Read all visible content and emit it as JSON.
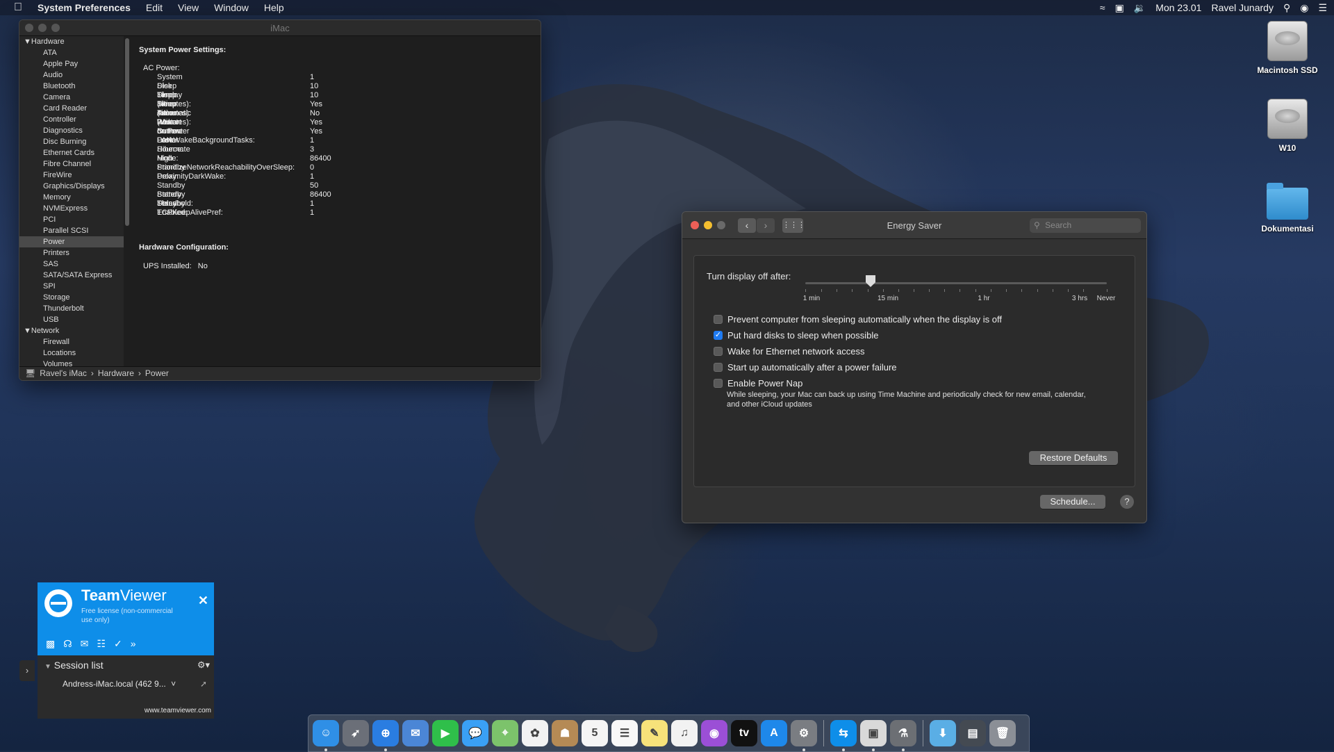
{
  "menubar": {
    "app_name": "System Preferences",
    "menus": [
      "Edit",
      "View",
      "Window",
      "Help"
    ],
    "clock": "Mon 23.01",
    "user": "Ravel Junardy"
  },
  "desktop": {
    "icons": [
      {
        "label": "Macintosh SSD",
        "icon": "hard-disk-icon"
      },
      {
        "label": "W10",
        "icon": "hard-disk-icon"
      },
      {
        "label": "Dokumentasi",
        "icon": "folder-icon"
      }
    ]
  },
  "sysinfo": {
    "title": "iMac",
    "sidebar_groups": [
      {
        "label": "Hardware",
        "items": [
          "ATA",
          "Apple Pay",
          "Audio",
          "Bluetooth",
          "Camera",
          "Card Reader",
          "Controller",
          "Diagnostics",
          "Disc Burning",
          "Ethernet Cards",
          "Fibre Channel",
          "FireWire",
          "Graphics/Displays",
          "Memory",
          "NVMExpress",
          "PCI",
          "Parallel SCSI",
          "Power",
          "Printers",
          "SAS",
          "SATA/SATA Express",
          "SPI",
          "Storage",
          "Thunderbolt",
          "USB"
        ]
      },
      {
        "label": "Network",
        "items": [
          "Firewall",
          "Locations",
          "Volumes"
        ]
      }
    ],
    "selected_item": "Power",
    "detail": {
      "power_settings_heading": "System Power Settings:",
      "ac_power_label": "AC Power:",
      "settings": [
        {
          "key": "System Sleep Timer (Minutes):",
          "value": "1"
        },
        {
          "key": "Disk Sleep Timer (Minutes):",
          "value": "10"
        },
        {
          "key": "Display Sleep Timer (Minutes):",
          "value": "10"
        },
        {
          "key": "Sleep on Power Button:",
          "value": "Yes"
        },
        {
          "key": "Automatic Restart on Power Loss:",
          "value": "No"
        },
        {
          "key": "Wake on LAN:",
          "value": "Yes"
        },
        {
          "key": "Current Power Source:",
          "value": "Yes"
        },
        {
          "key": "DarkWakeBackgroundTasks:",
          "value": "1"
        },
        {
          "key": "Hibernate Mode:",
          "value": "3"
        },
        {
          "key": "High Standby Delay:",
          "value": "86400"
        },
        {
          "key": "PrioritizeNetworkReachabilityOverSleep:",
          "value": "0"
        },
        {
          "key": "ProximityDarkWake:",
          "value": "1"
        },
        {
          "key": "Standby Battery Threshold:",
          "value": "50"
        },
        {
          "key": "Standby Delay:",
          "value": "86400"
        },
        {
          "key": "Standby Enabled:",
          "value": "1"
        },
        {
          "key": "TCPKeepAlivePref:",
          "value": "1"
        }
      ],
      "hardware_config_heading": "Hardware Configuration:",
      "ups_label": "UPS Installed:",
      "ups_value": "No"
    },
    "pathbar": [
      "Ravel's iMac",
      "Hardware",
      "Power"
    ]
  },
  "energy_saver": {
    "title": "Energy Saver",
    "search_placeholder": "Search",
    "slider": {
      "label": "Turn display off after:",
      "value_minutes": 10,
      "tick_labels": [
        "1 min",
        "15 min",
        "1 hr",
        "3 hrs",
        "Never"
      ]
    },
    "options": [
      {
        "label": "Prevent computer from sleeping automatically when the display is off",
        "checked": false
      },
      {
        "label": "Put hard disks to sleep when possible",
        "checked": true
      },
      {
        "label": "Wake for Ethernet network access",
        "checked": false
      },
      {
        "label": "Start up automatically after a power failure",
        "checked": false
      },
      {
        "label": "Enable Power Nap",
        "checked": false
      }
    ],
    "power_nap_note": "While sleeping, your Mac can back up using Time Machine and periodically check for new email, calendar, and other iCloud updates",
    "restore_button": "Restore Defaults",
    "schedule_button": "Schedule...",
    "help_label": "?"
  },
  "teamviewer": {
    "brand_team": "Team",
    "brand_viewer": "Viewer",
    "license": "Free license (non-commercial use only)",
    "session_list_label": "Session list",
    "device": "Andress-iMac.local (462 9...",
    "website": "www.teamviewer.com"
  },
  "dock": {
    "apps": [
      {
        "name": "finder-icon",
        "color": "#2f8fe6",
        "glyph": "☺",
        "running": true
      },
      {
        "name": "launchpad-icon",
        "color": "#6b6f78",
        "glyph": "➶",
        "running": false
      },
      {
        "name": "safari-icon",
        "color": "#2a7de1",
        "glyph": "⊕",
        "running": true
      },
      {
        "name": "mail-icon",
        "color": "#4b86d6",
        "glyph": "✉",
        "running": false
      },
      {
        "name": "facetime-icon",
        "color": "#2fbf4a",
        "glyph": "▶",
        "running": false
      },
      {
        "name": "messages-icon",
        "color": "#3aa0f5",
        "glyph": "💬",
        "running": false
      },
      {
        "name": "maps-icon",
        "color": "#7cc36b",
        "glyph": "⌖",
        "running": false
      },
      {
        "name": "photos-icon",
        "color": "#f2f2f2",
        "glyph": "✿",
        "running": false
      },
      {
        "name": "contacts-icon",
        "color": "#b58a55",
        "glyph": "☗",
        "running": false
      },
      {
        "name": "calendar-icon",
        "color": "#f5f5f5",
        "glyph": "5",
        "running": false
      },
      {
        "name": "reminders-icon",
        "color": "#f8f8f8",
        "glyph": "☰",
        "running": false
      },
      {
        "name": "notes-icon",
        "color": "#f7e27a",
        "glyph": "✎",
        "running": false
      },
      {
        "name": "music-icon",
        "color": "#f2f2f2",
        "glyph": "♫",
        "running": false
      },
      {
        "name": "podcasts-icon",
        "color": "#9b4fd6",
        "glyph": "◉",
        "running": false
      },
      {
        "name": "tv-icon",
        "color": "#111111",
        "glyph": "tv",
        "running": false
      },
      {
        "name": "app-store-icon",
        "color": "#1e88ea",
        "glyph": "A",
        "running": false
      },
      {
        "name": "system-preferences-icon",
        "color": "#7a7d82",
        "glyph": "⚙",
        "running": true
      }
    ],
    "apps_after_sep": [
      {
        "name": "teamviewer-icon",
        "color": "#0e8ee9",
        "glyph": "⇆",
        "running": true
      },
      {
        "name": "preview-icon",
        "color": "#d9d9d9",
        "glyph": "▣",
        "running": true
      },
      {
        "name": "system-information-icon",
        "color": "#6c6f74",
        "glyph": "⚗",
        "running": true
      }
    ],
    "stack_items": [
      {
        "name": "downloads-folder-icon",
        "color": "#5aaee5",
        "glyph": "⬇"
      },
      {
        "name": "screenshots-stack-icon",
        "color": "#444a52",
        "glyph": "▤"
      },
      {
        "name": "trash-icon",
        "color": "#8b8f96",
        "glyph": "🗑"
      }
    ]
  }
}
